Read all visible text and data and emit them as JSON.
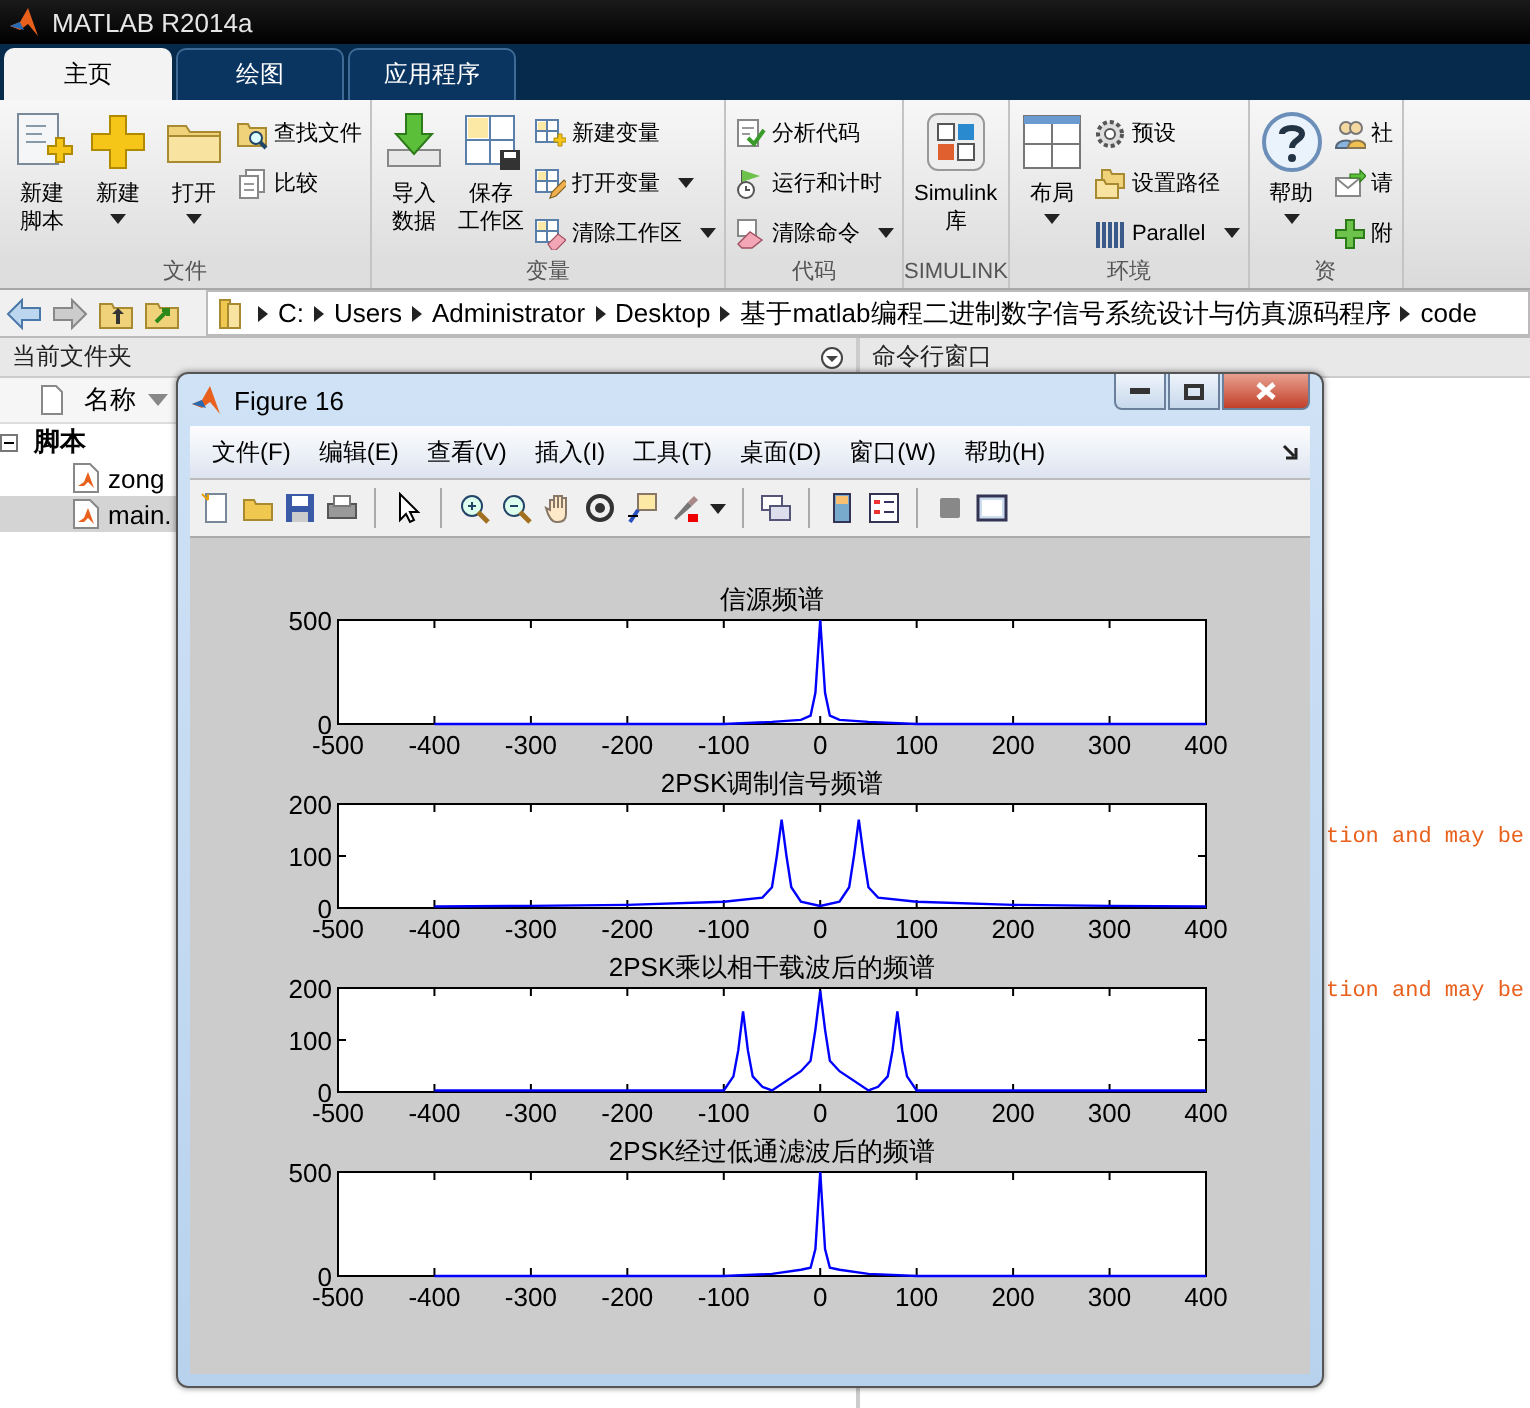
{
  "window": {
    "title": "MATLAB R2014a"
  },
  "tabs": [
    {
      "label": "主页",
      "selected": true
    },
    {
      "label": "绘图",
      "selected": false
    },
    {
      "label": "应用程序",
      "selected": false
    }
  ],
  "ribbon": [
    {
      "title": "文件",
      "groups": [
        {
          "kind": "large",
          "lines": [
            "新建",
            "脚本"
          ],
          "dropdown": false
        },
        {
          "kind": "large",
          "lines": [
            "新建"
          ],
          "dropdown": true
        },
        {
          "kind": "large",
          "lines": [
            "打开"
          ],
          "dropdown": true
        },
        {
          "kind": "column",
          "items": [
            {
              "label": "查找文件",
              "dropdown": false
            },
            {
              "label": "比较",
              "dropdown": false
            }
          ]
        }
      ]
    },
    {
      "title": "变量",
      "groups": [
        {
          "kind": "large",
          "lines": [
            "导入",
            "数据"
          ],
          "dropdown": false
        },
        {
          "kind": "large",
          "lines": [
            "保存",
            "工作区"
          ],
          "dropdown": false
        },
        {
          "kind": "column",
          "items": [
            {
              "label": "新建变量",
              "dropdown": false
            },
            {
              "label": "打开变量",
              "dropdown": true
            },
            {
              "label": "清除工作区",
              "dropdown": true
            }
          ]
        }
      ]
    },
    {
      "title": "代码",
      "groups": [
        {
          "kind": "column",
          "items": [
            {
              "label": "分析代码",
              "dropdown": false
            },
            {
              "label": "运行和计时",
              "dropdown": false
            },
            {
              "label": "清除命令",
              "dropdown": true
            }
          ]
        }
      ]
    },
    {
      "title": "SIMULINK",
      "groups": [
        {
          "kind": "large",
          "lines": [
            "Simulink",
            "库"
          ],
          "dropdown": false
        }
      ]
    },
    {
      "title": "环境",
      "groups": [
        {
          "kind": "large",
          "lines": [
            "布局"
          ],
          "dropdown": true
        },
        {
          "kind": "column",
          "items": [
            {
              "label": "预设",
              "dropdown": false
            },
            {
              "label": "设置路径",
              "dropdown": false
            },
            {
              "label": "Parallel",
              "dropdown": true
            }
          ]
        }
      ]
    },
    {
      "title": "资",
      "groups": [
        {
          "kind": "large",
          "lines": [
            "帮助"
          ],
          "dropdown": true
        },
        {
          "kind": "column",
          "items": [
            {
              "label": "社",
              "dropdown": false
            },
            {
              "label": "请",
              "dropdown": false
            },
            {
              "label": "附",
              "dropdown": false
            }
          ]
        }
      ]
    }
  ],
  "address_bar": {
    "path": [
      "C:",
      "Users",
      "Administrator",
      "Desktop",
      "基于matlab编程二进制数字信号系统设计与仿真源码程序",
      "code"
    ]
  },
  "file_panel": {
    "title": "当前文件夹",
    "column": "名称",
    "tree": [
      {
        "label": "脚本",
        "expanded": true,
        "children": [
          {
            "label": "zong",
            "selected": false
          },
          {
            "label": "main.",
            "selected": true
          }
        ]
      }
    ]
  },
  "command_window": {
    "title": "命令行窗口",
    "lines": [
      "tion and may be",
      "tion and may be"
    ]
  },
  "figure": {
    "title": "Figure 16",
    "menu": [
      "文件(F)",
      "编辑(E)",
      "查看(V)",
      "插入(I)",
      "工具(T)",
      "桌面(D)",
      "窗口(W)",
      "帮助(H)"
    ],
    "plots": [
      {
        "chart_data": {
          "type": "line",
          "title": "信源频谱",
          "x": [
            -400,
            -300,
            -200,
            -100,
            -50,
            -20,
            -10,
            -5,
            0,
            5,
            10,
            20,
            50,
            100,
            200,
            300,
            400
          ],
          "series": [
            {
              "color": "#0000ff",
              "values": [
                0,
                0,
                0,
                0,
                10,
                20,
                40,
                150,
                500,
                150,
                40,
                20,
                10,
                0,
                0,
                0,
                0
              ]
            }
          ],
          "xlim": [
            -500,
            400
          ],
          "ylim": [
            0,
            500
          ],
          "xticks": [
            -500,
            -400,
            -300,
            -200,
            -100,
            0,
            100,
            200,
            300,
            400
          ],
          "yticks": [
            0,
            500
          ]
        }
      },
      {
        "chart_data": {
          "type": "line",
          "title": "2PSK调制信号频谱",
          "x": [
            -400,
            -300,
            -200,
            -100,
            -60,
            -50,
            -45,
            -40,
            -35,
            -30,
            -20,
            0,
            20,
            30,
            35,
            40,
            45,
            50,
            60,
            100,
            200,
            300,
            400
          ],
          "series": [
            {
              "color": "#0000ff",
              "values": [
                3,
                4,
                6,
                12,
                20,
                40,
                100,
                170,
                100,
                40,
                12,
                4,
                12,
                40,
                100,
                170,
                100,
                40,
                20,
                12,
                6,
                4,
                3
              ]
            }
          ],
          "xlim": [
            -500,
            400
          ],
          "ylim": [
            0,
            200
          ],
          "xticks": [
            -500,
            -400,
            -300,
            -200,
            -100,
            0,
            100,
            200,
            300,
            400
          ],
          "yticks": [
            0,
            100,
            200
          ]
        }
      },
      {
        "chart_data": {
          "type": "line",
          "title": "2PSK乘以相干载波后的频谱",
          "x": [
            -400,
            -300,
            -200,
            -100,
            -90,
            -85,
            -80,
            -75,
            -70,
            -60,
            -50,
            -20,
            -10,
            -5,
            0,
            5,
            10,
            20,
            50,
            60,
            70,
            75,
            80,
            85,
            90,
            100,
            200,
            300,
            400
          ],
          "series": [
            {
              "color": "#0000ff",
              "values": [
                3,
                3,
                3,
                3,
                30,
                80,
                155,
                80,
                30,
                10,
                3,
                40,
                60,
                120,
                195,
                120,
                60,
                40,
                3,
                10,
                30,
                80,
                155,
                80,
                30,
                3,
                3,
                3,
                3
              ]
            }
          ],
          "xlim": [
            -500,
            400
          ],
          "ylim": [
            0,
            200
          ],
          "xticks": [
            -500,
            -400,
            -300,
            -200,
            -100,
            0,
            100,
            200,
            300,
            400
          ],
          "yticks": [
            0,
            100,
            200
          ]
        }
      },
      {
        "chart_data": {
          "type": "line",
          "title": "2PSK经过低通滤波后的频谱",
          "x": [
            -400,
            -300,
            -200,
            -100,
            -50,
            -20,
            -10,
            -5,
            0,
            5,
            10,
            20,
            50,
            100,
            200,
            300,
            400
          ],
          "series": [
            {
              "color": "#0000ff",
              "values": [
                0,
                0,
                0,
                0,
                10,
                30,
                40,
                130,
                500,
                130,
                40,
                30,
                10,
                0,
                0,
                0,
                0
              ]
            }
          ],
          "xlim": [
            -500,
            400
          ],
          "ylim": [
            0,
            500
          ],
          "xticks": [
            -500,
            -400,
            -300,
            -200,
            -100,
            0,
            100,
            200,
            300,
            400
          ],
          "yticks": [
            0,
            500
          ]
        }
      }
    ]
  }
}
